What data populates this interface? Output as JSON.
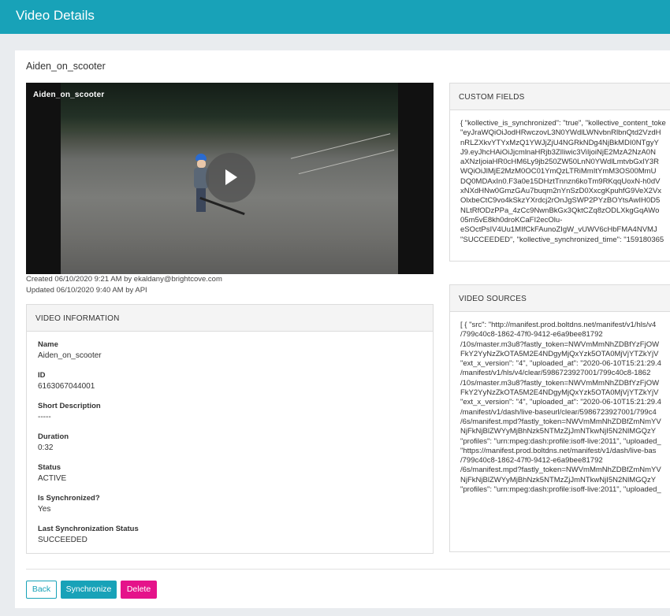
{
  "header": {
    "title": "Video Details"
  },
  "video": {
    "name": "Aiden_on_scooter",
    "overlay_title": "Aiden_on_scooter",
    "created": "Created 06/10/2020 9:21 AM by ekaldany@brightcove.com",
    "updated": "Updated 06/10/2020 9:40 AM by API"
  },
  "video_information": {
    "heading": "VIDEO INFORMATION",
    "fields": [
      {
        "label": "Name",
        "value": "Aiden_on_scooter"
      },
      {
        "label": "ID",
        "value": "6163067044001"
      },
      {
        "label": "Short Description",
        "value": "-----"
      },
      {
        "label": "Duration",
        "value": "0:32"
      },
      {
        "label": "Status",
        "value": "ACTIVE"
      },
      {
        "label": "Is Synchronized?",
        "value": "Yes"
      },
      {
        "label": "Last Synchronization Status",
        "value": "SUCCEEDED"
      }
    ]
  },
  "custom_fields": {
    "heading": "CUSTOM FIELDS",
    "text": "{ \"kollective_is_synchronized\": \"true\", \"kollective_content_toke\n\"eyJraWQiOiJodHRwczovL3N0YWdlLWNvbnRlbnQtd2VzdH\nnRLZXkvYTYxMzQ1YWJjZjU4NGRkNDg4NjBkMDI0NTgyY\nJ9.eyJhcHAiOiJjcmlnaHRjb3ZlIiwic3ViIjoiNjE2MzA2NzA0N\naXNzIjoiaHR0cHM6Ly9jb250ZW50LnN0YWdlLmtvbGxlY3R\nWQiOiJlMjE2MzM0OC01YmQzLTRiMmItYmM3OS00MmU\nDQ0MDAxIn0.F3a0e15DHztTnnzn6koTm9RKqqUoxN-h0dV\nxNXdHNw0GmzGAu7buqm2nYnSzD0XxcgKpuhfG9VeX2Vx\nOlxbeCtC9vo4kSkzYXrdcj2rOnJgSWP2PYzBOYtsAwIH0D5\nNLtRfODzPPa_4zCc9NwnBkGx3QktCZq8zODLXkgGqAWo\n05m5vE8kh0droKCaFI2ecOlu-\neSOctPsIV4Uu1MIfCkFAunoZIgW_vUWV6cHbFMA4NVMJ\n\"SUCCEEDED\", \"kollective_synchronized_time\": \"159180365"
  },
  "video_sources": {
    "heading": "VIDEO SOURCES",
    "text": "[ { \"src\": \"http://manifest.prod.boltdns.net/manifest/v1/hls/v4\n/799c40c8-1862-47f0-9412-e6a9bee81792\n/10s/master.m3u8?fastly_token=NWVmMmNhZDBfYzFjOW\nFkY2YyNzZkOTA5M2E4NDgyMjQxYzk5OTA0MjVjYTZkYjV\n\"ext_x_version\": \"4\", \"uploaded_at\": \"2020-06-10T15:21:29.4\n/manifest/v1/hls/v4/clear/5986723927001/799c40c8-1862\n/10s/master.m3u8?fastly_token=NWVmMmNhZDBfYzFjOW\nFkY2YyNzZkOTA5M2E4NDgyMjQxYzk5OTA0MjVjYTZkYjV\n\"ext_x_version\": \"4\", \"uploaded_at\": \"2020-06-10T15:21:29.4\n/manifest/v1/dash/live-baseurl/clear/5986723927001/799c4\n/6s/manifest.mpd?fastly_token=NWVmMmNhZDBfZmNmYV\nNjFkNjBlZWYyMjBhNzk5NTMzZjJmNTkwNjI5N2NlMGQzY\n\"profiles\": \"urn:mpeg:dash:profile:isoff-live:2011\", \"uploaded_\n\"https://manifest.prod.boltdns.net/manifest/v1/dash/live-bas\n/799c40c8-1862-47f0-9412-e6a9bee81792\n/6s/manifest.mpd?fastly_token=NWVmMmNhZDBfZmNmYV\nNjFkNjBlZWYyMjBhNzk5NTMzZjJmNTkwNjI5N2NlMGQzY\n\"profiles\": \"urn:mpeg:dash:profile:isoff-live:2011\", \"uploaded_"
  },
  "actions": {
    "back": "Back",
    "synchronize": "Synchronize",
    "delete": "Delete"
  },
  "colors": {
    "brand": "#18a2b8",
    "delete": "#e5138a"
  }
}
